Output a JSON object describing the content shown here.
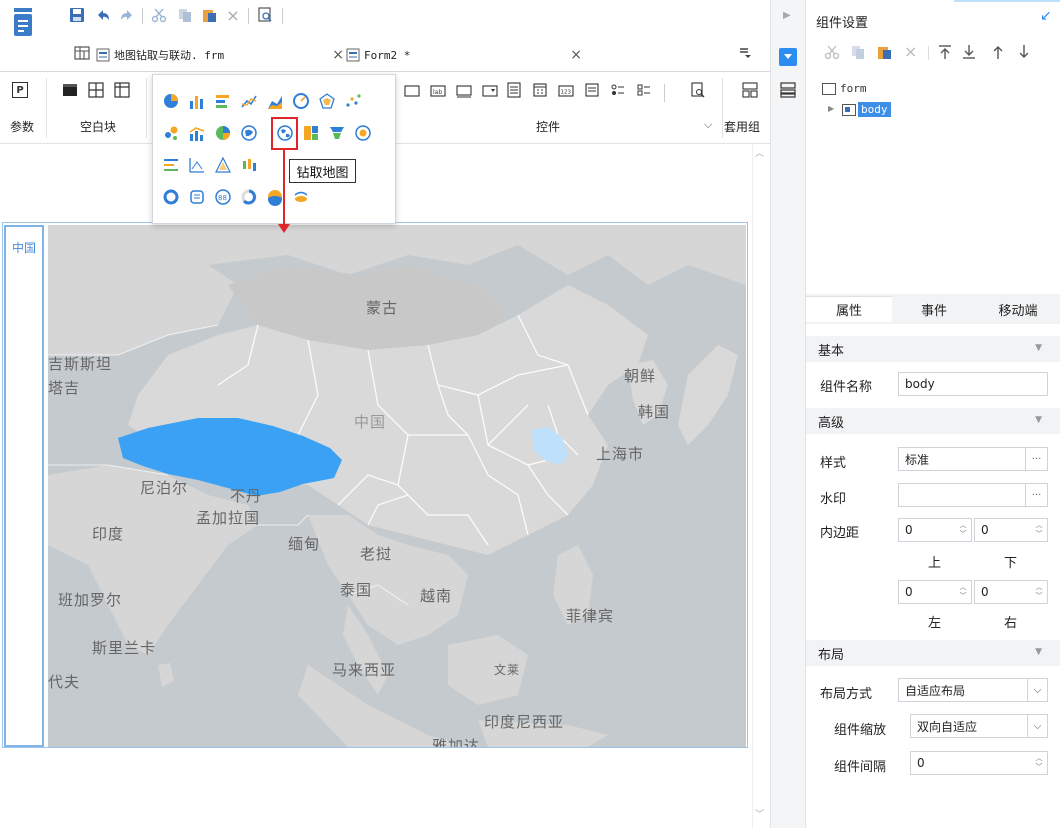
{
  "topbar": {
    "icons": [
      "save-icon",
      "undo-icon",
      "redo-icon",
      "cut-icon",
      "copy-icon",
      "paste-icon",
      "delete-icon",
      "preview-icon"
    ]
  },
  "tabs": [
    {
      "label": "地图钻取与联动. frm",
      "close": "×"
    },
    {
      "label": "Form2 *",
      "close": "×"
    }
  ],
  "ribbon": {
    "param_label": "参数",
    "blank_label": "空白块",
    "controls_label": "控件",
    "template_label": "套用组",
    "p_glyph": "P"
  },
  "chart_menu": {
    "tooltip": "钻取地图"
  },
  "canvas": {
    "left_strip_label": "中国"
  },
  "map": {
    "labels": {
      "mongolia": "蒙古",
      "kazakhstan": "吉斯斯坦",
      "tajik": "塔吉",
      "china": "中国",
      "korea_n": "朝鲜",
      "korea_s": "韩国",
      "shanghai": "上海市",
      "nepal": "尼泊尔",
      "bhutan": "不丹",
      "bangladesh": "孟加拉国",
      "india": "印度",
      "myanmar": "缅甸",
      "laos": "老挝",
      "thailand": "泰国",
      "vietnam": "越南",
      "philippines": "菲律宾",
      "bengaluru": "班加罗尔",
      "srilanka": "斯里兰卡",
      "maldives": "代夫",
      "malaysia": "马来西亚",
      "brunei": "文莱",
      "indonesia": "印度尼西亚",
      "jakarta": "雅加达"
    },
    "highlight_color": "#3aa1f4",
    "land_color": "#d9d9d9",
    "sea_color": "#c4cace"
  },
  "panel": {
    "title": "组件设置",
    "tree": {
      "root": "form",
      "child": "body"
    },
    "tabs": [
      "属性",
      "事件",
      "移动端"
    ],
    "sections": {
      "basic": "基本",
      "advanced": "高级",
      "layout": "布局"
    },
    "fields": {
      "name_label": "组件名称",
      "name_value": "body",
      "style_label": "样式",
      "style_value": "标准",
      "watermark_label": "水印",
      "watermark_value": "",
      "padding_label": "内边距",
      "pad_top": "0",
      "pad_bottom": "0",
      "pad_left": "0",
      "pad_right": "0",
      "top_label": "上",
      "bottom_label": "下",
      "left_label": "左",
      "right_label": "右",
      "layout_mode_label": "布局方式",
      "layout_mode_value": "自适应布局",
      "scale_label": "组件缩放",
      "scale_value": "双向自适应",
      "gap_label": "组件间隔",
      "gap_value": "0"
    },
    "dots": "···"
  }
}
